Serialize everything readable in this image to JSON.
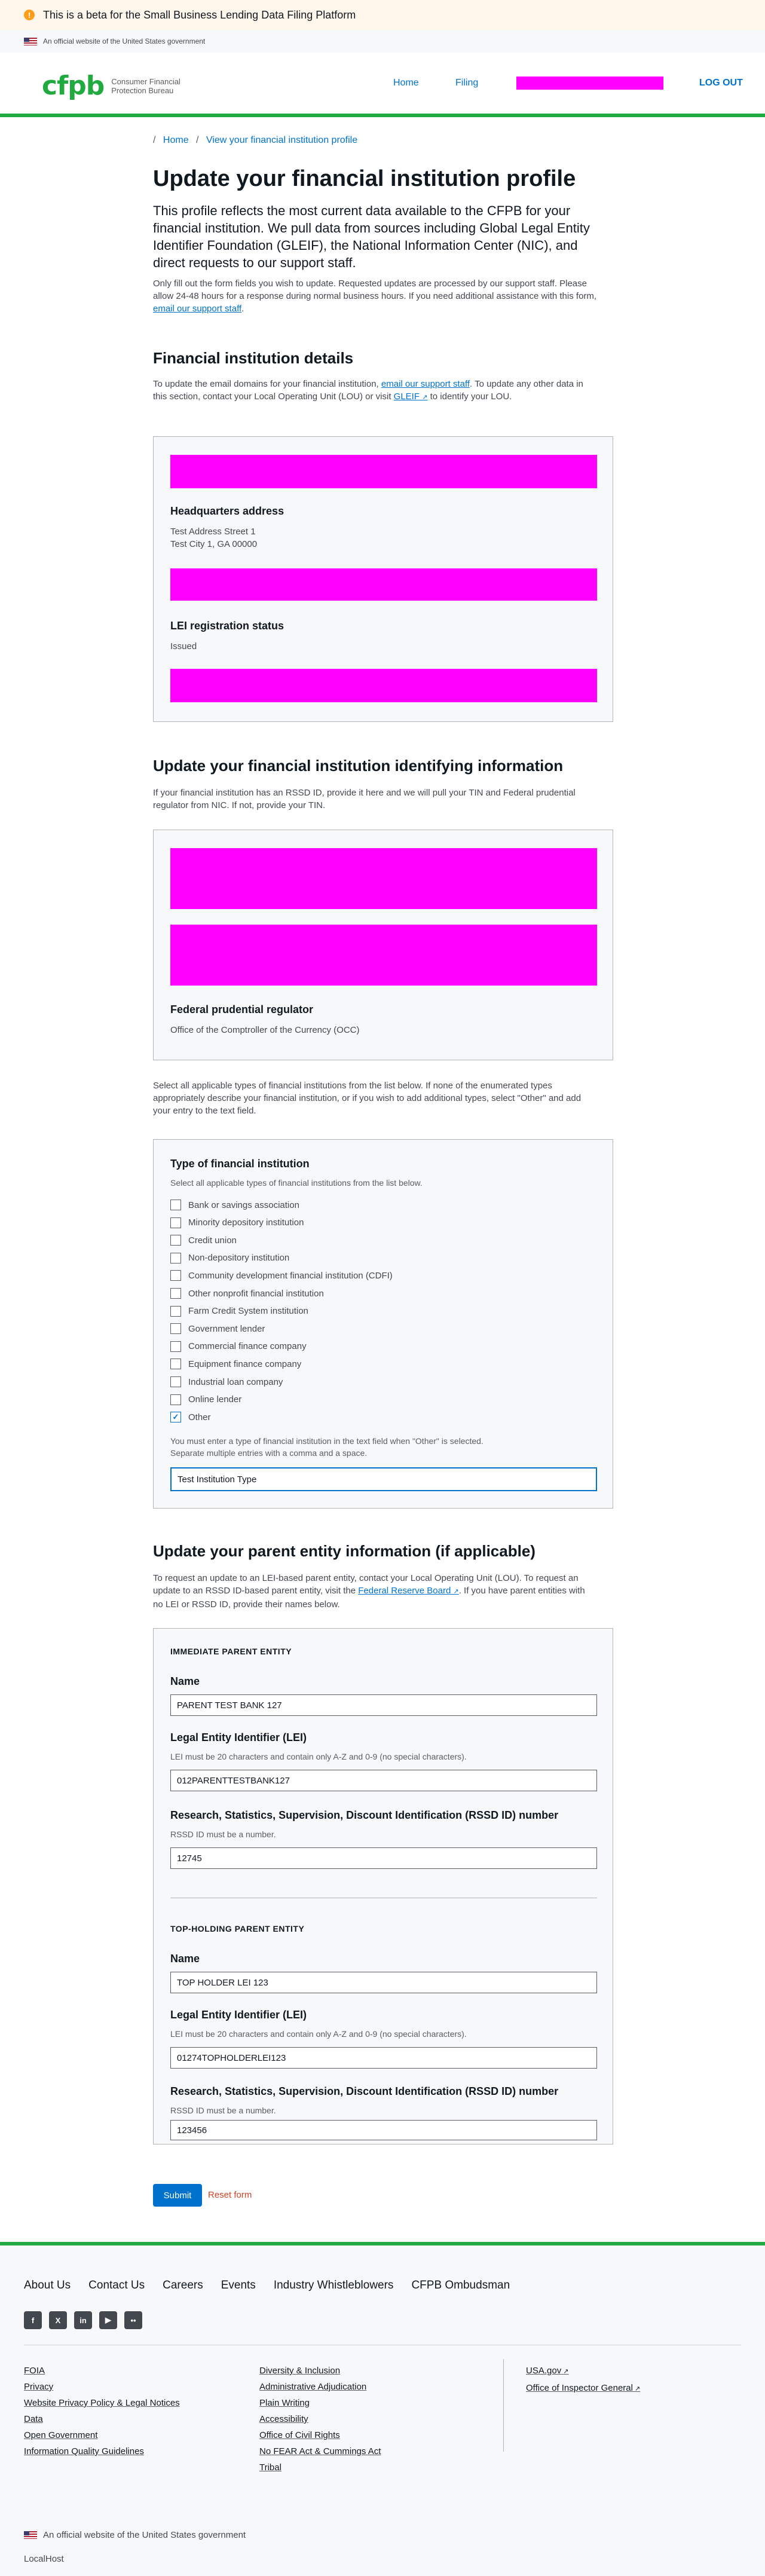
{
  "beta_banner": {
    "icon": "warning-icon",
    "text": "This is a beta for the Small Business Lending Data Filing Platform"
  },
  "gov_banner": {
    "text": "An official website of the United States government"
  },
  "header": {
    "logo_mark": "cfpb",
    "logo_line1": "Consumer Financial",
    "logo_line2": "Protection Bureau",
    "nav_home": "Home",
    "nav_filing": "Filing",
    "nav_logout": "LOG OUT"
  },
  "breadcrumb": {
    "home": "Home",
    "profile": "View your financial institution profile"
  },
  "page": {
    "title": "Update your financial institution profile",
    "lead": "This profile reflects the most current data available to the CFPB for your financial institution. We pull data from sources including Global Legal Entity Identifier Foundation (GLEIF), the National Information Center (NIC), and direct requests to our support staff.",
    "note_prefix": "Only fill out the form fields you wish to update. Requested updates are processed by our support staff. Please allow 24-48 hours for a response during normal business hours. If you need additional assistance with this form, ",
    "note_link": "email our support staff",
    "note_suffix": "."
  },
  "details": {
    "heading": "Financial institution details",
    "para_a": "To update the email domains for your financial institution, ",
    "para_link1": "email our support staff",
    "para_b": ". To update any other data in this section, contact your Local Operating Unit (LOU) or visit ",
    "para_link2": "GLEIF",
    "para_c": " to identify your LOU.",
    "hq_label": "Headquarters address",
    "hq_line1": "Test Address Street 1",
    "hq_line2": "Test City 1, GA 00000",
    "lei_status_label": "LEI registration status",
    "lei_status_value": "Issued"
  },
  "identifying": {
    "heading": "Update your financial institution identifying information",
    "para": "If your financial institution has an RSSD ID, provide it here and we will pull your TIN and Federal prudential regulator from NIC. If not, provide your TIN.",
    "regulator_label": "Federal prudential regulator",
    "regulator_value": "Office of the Comptroller of the Currency (OCC)"
  },
  "types": {
    "intro": "Select all applicable types of financial institutions from the list below. If none of the enumerated types appropriately describe your financial institution, or if you wish to add additional types, select \"Other\" and add your entry to the text field.",
    "label": "Type of financial institution",
    "hint": "Select all applicable types of financial institutions from the list below.",
    "options": [
      {
        "label": "Bank or savings association",
        "checked": false
      },
      {
        "label": "Minority depository institution",
        "checked": false
      },
      {
        "label": "Credit union",
        "checked": false
      },
      {
        "label": "Non-depository institution",
        "checked": false
      },
      {
        "label": "Community development financial institution (CDFI)",
        "checked": false
      },
      {
        "label": "Other nonprofit financial institution",
        "checked": false
      },
      {
        "label": "Farm Credit System institution",
        "checked": false
      },
      {
        "label": "Government lender",
        "checked": false
      },
      {
        "label": "Commercial finance company",
        "checked": false
      },
      {
        "label": "Equipment finance company",
        "checked": false
      },
      {
        "label": "Industrial loan company",
        "checked": false
      },
      {
        "label": "Online lender",
        "checked": false
      },
      {
        "label": "Other",
        "checked": true
      }
    ],
    "other_hint_1": "You must enter a type of financial institution in the text field when \"Other\" is selected.",
    "other_hint_2": "Separate multiple entries with a comma and a space.",
    "other_value": "Test Institution Type"
  },
  "parent": {
    "heading": "Update your parent entity information (if applicable)",
    "para_a": "To request an update to an LEI-based parent entity, contact your Local Operating Unit (LOU). To request an update to an RSSD ID-based parent entity, visit the ",
    "para_link": "Federal Reserve Board",
    "para_b": ". If you have parent entities with no LEI or RSSD ID, provide their names below.",
    "immediate": {
      "caption": "IMMEDIATE PARENT ENTITY",
      "name_label": "Name",
      "name_value": "PARENT TEST BANK 127",
      "lei_label": "Legal Entity Identifier (LEI)",
      "lei_hint": "LEI must be 20 characters and contain only A-Z and 0-9 (no special characters).",
      "lei_value": "012PARENTTESTBANK127",
      "rssd_label": "Research, Statistics, Supervision, Discount Identification (RSSD ID) number",
      "rssd_hint": "RSSD ID must be a number.",
      "rssd_value": "12745"
    },
    "top": {
      "caption": "TOP-HOLDING PARENT ENTITY",
      "name_label": "Name",
      "name_value": "TOP HOLDER LEI 123",
      "lei_label": "Legal Entity Identifier (LEI)",
      "lei_hint": "LEI must be 20 characters and contain only A-Z and 0-9 (no special characters).",
      "lei_value": "01274TOPHOLDERLEI123",
      "rssd_label": "Research, Statistics, Supervision, Discount Identification (RSSD ID) number",
      "rssd_hint": "RSSD ID must be a number.",
      "rssd_value": "123456"
    }
  },
  "actions": {
    "submit": "Submit",
    "reset": "Reset form"
  },
  "footer": {
    "links": [
      "About Us",
      "Contact Us",
      "Careers",
      "Events",
      "Industry Whistleblowers",
      "CFPB Ombudsman"
    ],
    "socials": [
      {
        "icon": "facebook-icon",
        "glyph": "f"
      },
      {
        "icon": "x-icon",
        "glyph": "X"
      },
      {
        "icon": "linkedin-icon",
        "glyph": "in"
      },
      {
        "icon": "youtube-icon",
        "glyph": "▶"
      },
      {
        "icon": "flickr-icon",
        "glyph": "••"
      }
    ],
    "col1": [
      "FOIA",
      "Privacy",
      "Website Privacy Policy & Legal Notices",
      "Data",
      "Open Government",
      "Information Quality Guidelines"
    ],
    "col2": [
      "Diversity & Inclusion",
      "Administrative Adjudication",
      "Plain Writing",
      "Accessibility",
      "Office of Civil Rights",
      "No FEAR Act & Cummings Act",
      "Tribal"
    ],
    "col3": [
      "USA.gov",
      "Office of Inspector General"
    ],
    "gov_text": "An official website of the United States government",
    "host": "LocalHost"
  },
  "colors": {
    "brand_green": "#20aa3f",
    "link_blue": "#0072ce",
    "redaction": "#ff00ff",
    "reset_red": "#d14124",
    "beta_orange": "#ff9e1b"
  }
}
